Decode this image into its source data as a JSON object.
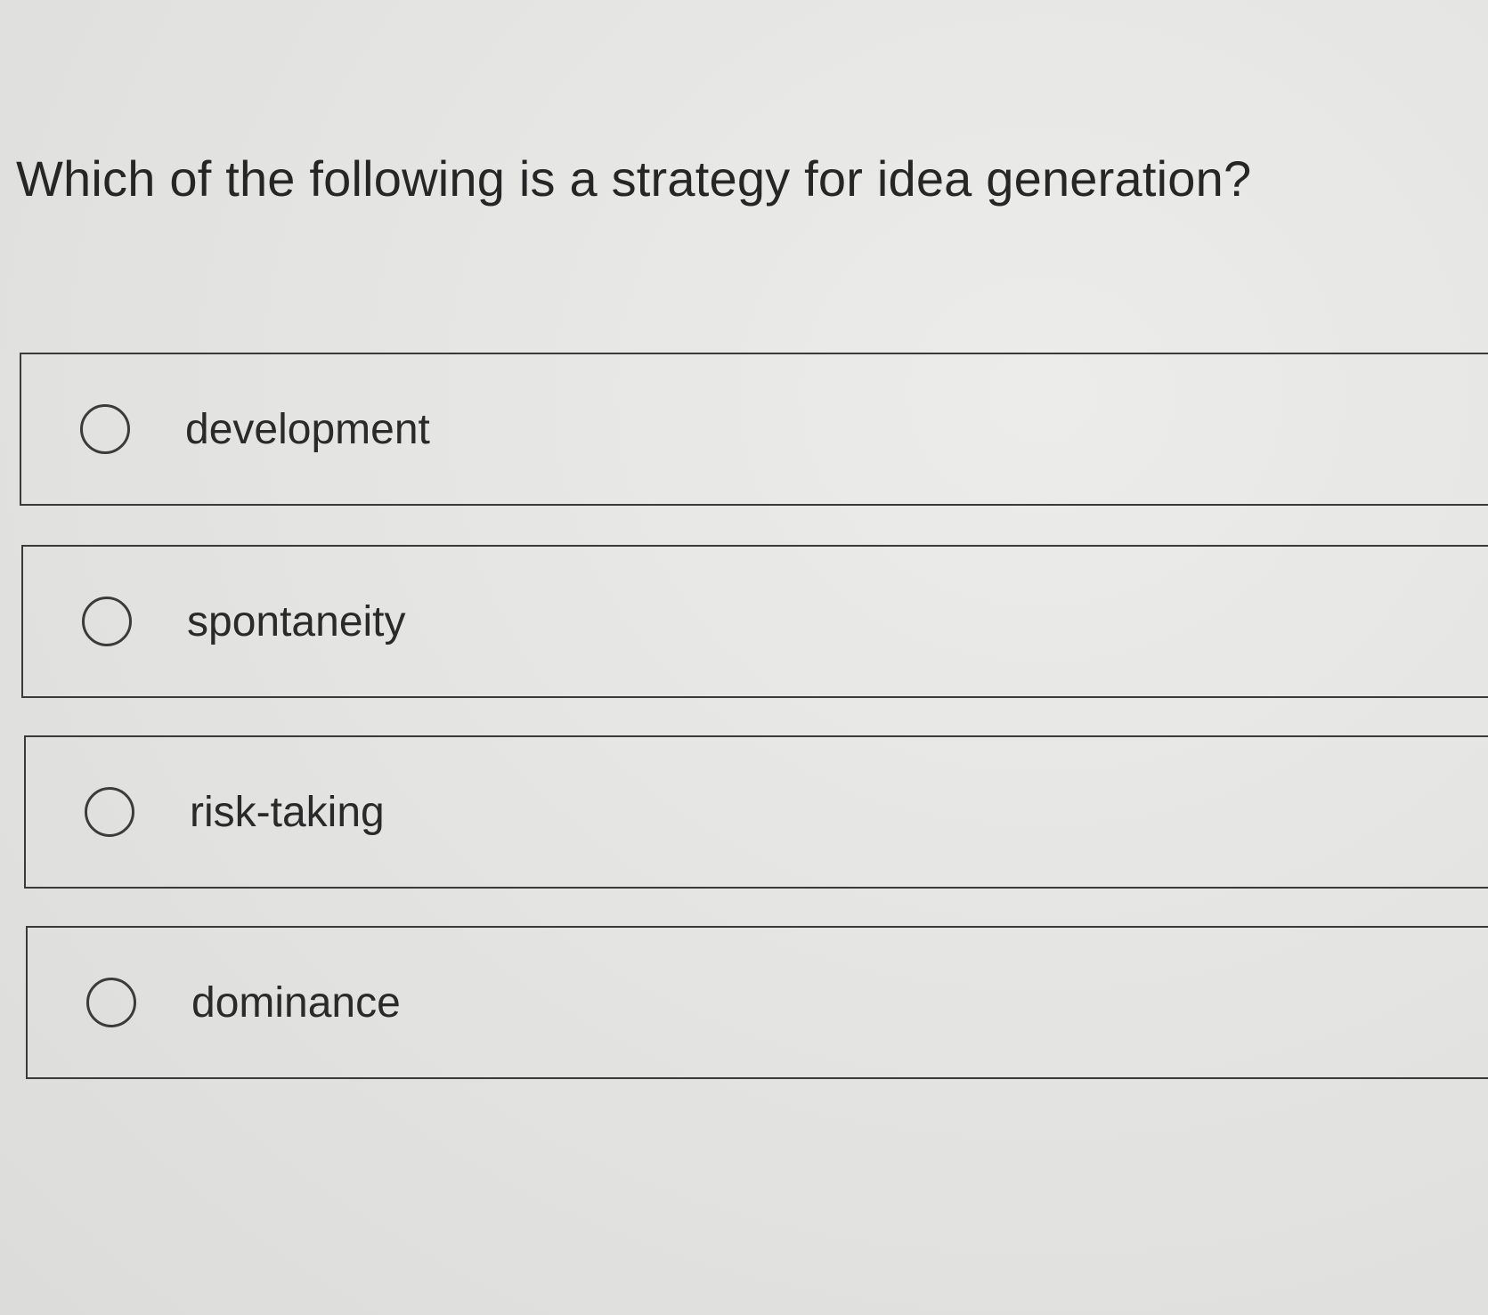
{
  "question": {
    "text": "Which of the following is a strategy for idea generation?"
  },
  "options": [
    {
      "label": "development",
      "selected": false
    },
    {
      "label": "spontaneity",
      "selected": false
    },
    {
      "label": "risk-taking",
      "selected": false
    },
    {
      "label": "dominance",
      "selected": false
    }
  ],
  "colors": {
    "background": "#e4e4e2",
    "border": "#3a3a3a",
    "text": "#2a2a2a"
  }
}
